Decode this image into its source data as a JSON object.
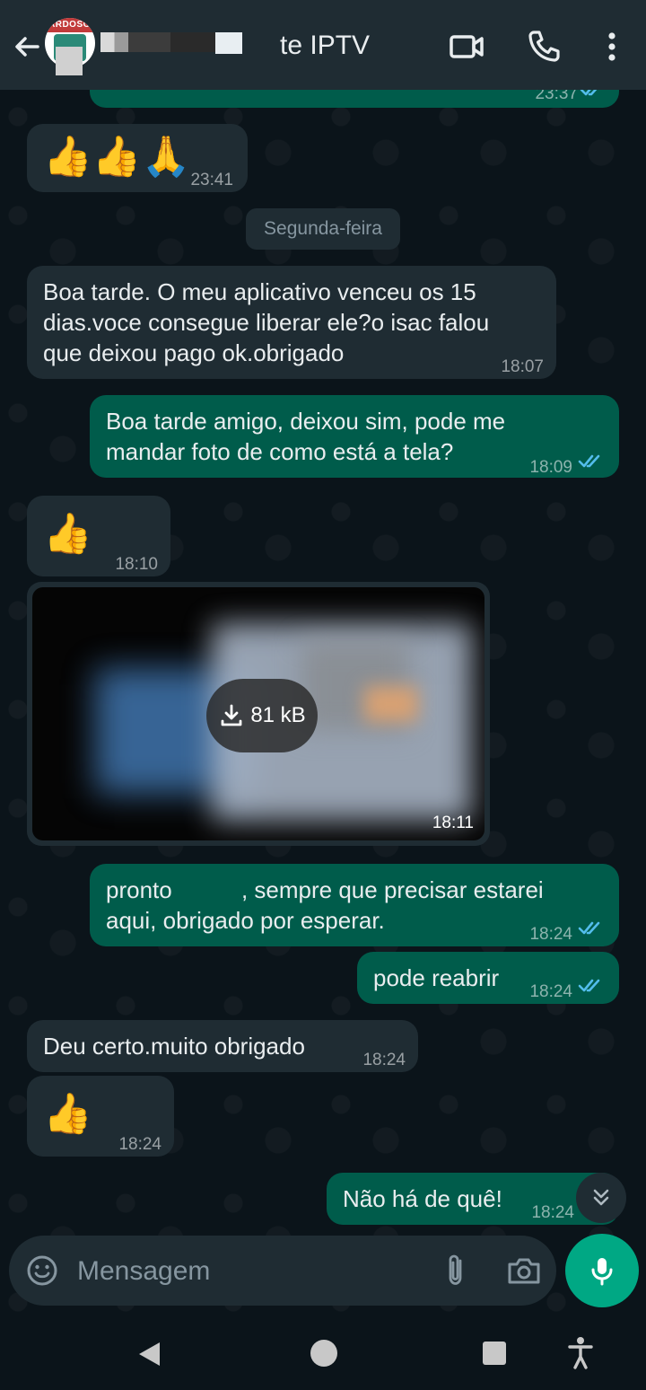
{
  "header": {
    "avatar_text": "ARDOSO",
    "contact_name": "te IPTV"
  },
  "date_chip": "Segunda-feira",
  "messages": [
    {
      "dir": "out",
      "text": "",
      "time": "23:37",
      "ticks": true
    },
    {
      "dir": "in",
      "emoji": "👍👍🙏",
      "time": "23:41"
    },
    {
      "dir": "in",
      "text": "Boa tarde. O meu aplicativo venceu os 15\ndias.voce consegue liberar ele?o isac falou\nque deixou pago ok.obrigado",
      "time": "18:07"
    },
    {
      "dir": "out",
      "text": "Boa tarde amigo, deixou sim, pode me\nmandar foto de como está a tela?",
      "time": "18:09",
      "ticks": true
    },
    {
      "dir": "in",
      "emoji": "👍",
      "time": "18:10"
    },
    {
      "dir": "in",
      "image": true,
      "size": "81 kB",
      "time": "18:11"
    },
    {
      "dir": "out",
      "text_a": "pronto",
      "text_b": ", sempre que precisar estarei",
      "text_c": "aqui, obrigado por esperar.",
      "time": "18:24",
      "ticks": true
    },
    {
      "dir": "out",
      "text": "pode reabrir",
      "time": "18:24",
      "ticks": true
    },
    {
      "dir": "in",
      "text": "Deu certo.muito obrigado",
      "time": "18:24"
    },
    {
      "dir": "in",
      "emoji": "👍",
      "time": "18:24"
    },
    {
      "dir": "out",
      "text": "Não há de quê!",
      "time": "18:24"
    }
  ],
  "composer": {
    "placeholder": "Mensagem"
  },
  "colors": {
    "background": "#0b141a",
    "incoming": "#1f2c33",
    "outgoing": "#005c4b",
    "accent": "#00a884",
    "read_ticks": "#53bdeb"
  },
  "icons": {
    "back": "arrow-left-icon",
    "video": "video-camera-icon",
    "call": "phone-icon",
    "menu": "more-vertical-icon",
    "emoji": "smiley-icon",
    "attach": "paperclip-icon",
    "camera": "camera-icon",
    "mic": "microphone-icon",
    "scroll": "double-chevron-down-icon",
    "download": "download-icon"
  }
}
